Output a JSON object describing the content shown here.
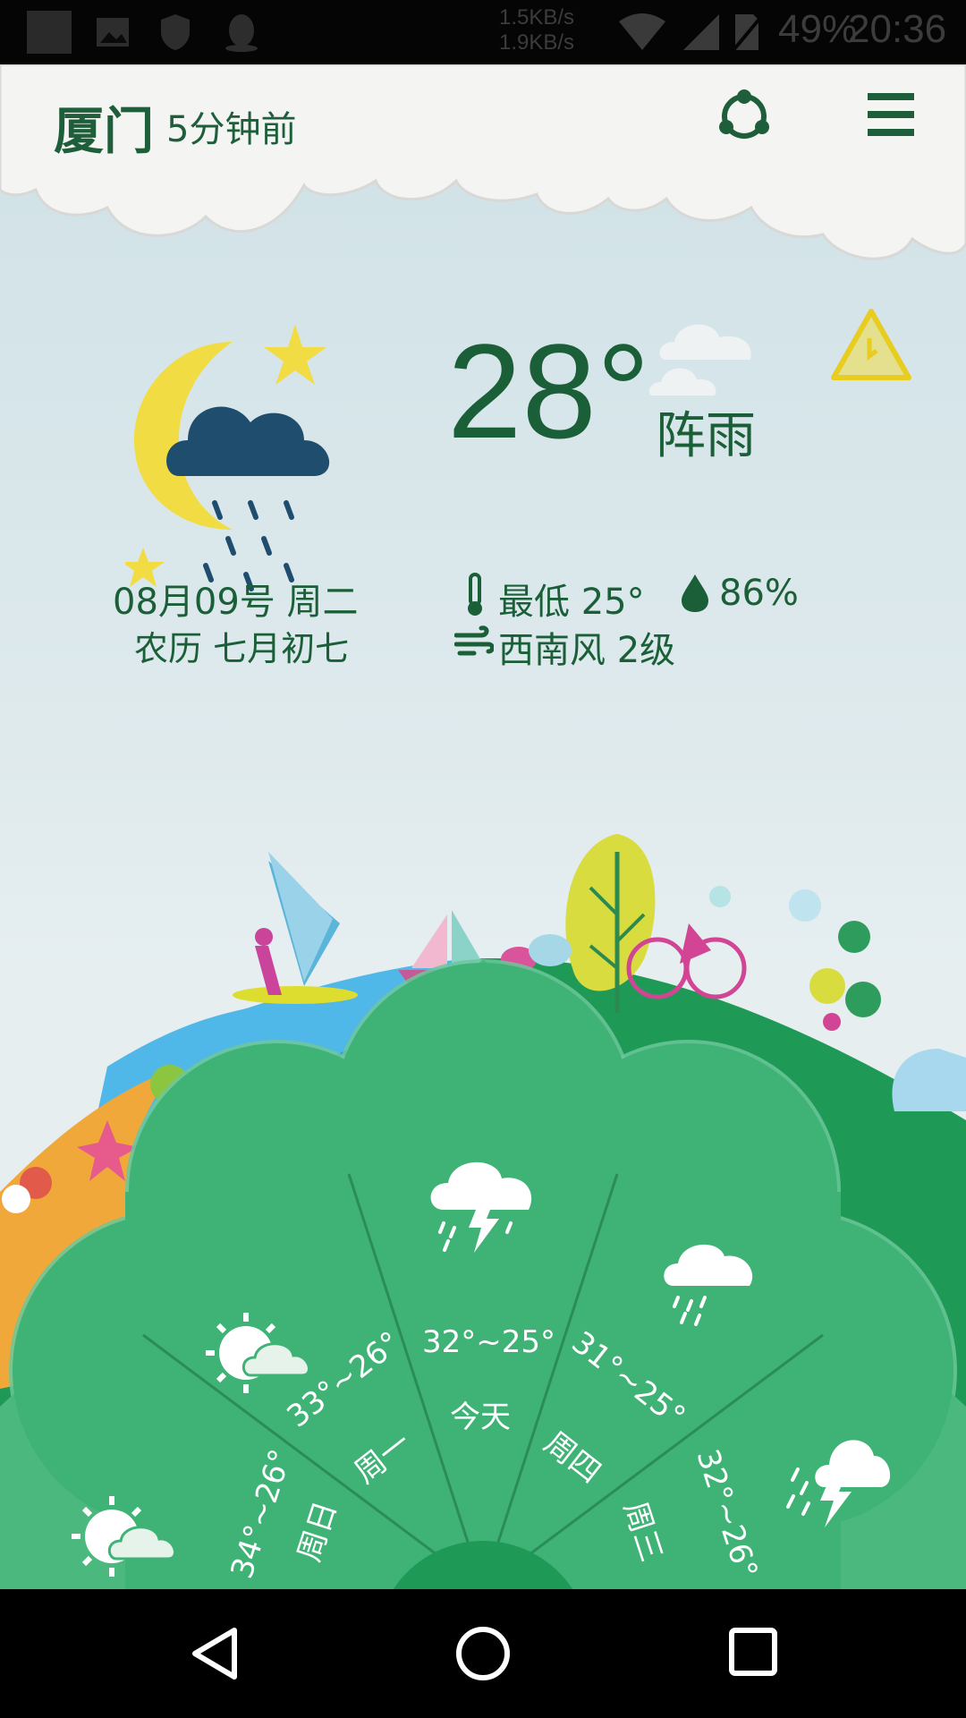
{
  "status_bar": {
    "net_up": "1.5KB/s",
    "net_down": "1.9KB/s",
    "battery": "49%",
    "time": "20:36",
    "icons": [
      "app-icon",
      "image-icon",
      "shield-icon",
      "qq-icon",
      "wifi-icon",
      "signal-icon",
      "no-sim-icon"
    ]
  },
  "header": {
    "city": "厦门",
    "updated": "5分钟前",
    "share_icon": "share-icon",
    "menu_icon": "menu-icon"
  },
  "current": {
    "temperature": "28°",
    "condition": "阵雨",
    "date": "08月09号 周二",
    "lunar": "农历 七月初七",
    "low": "最低 25°",
    "humidity": "86%",
    "wind": "西南风 2级",
    "weather_icon": "moon-cloud-rain-icon",
    "alert_icon": "warning-icon"
  },
  "forecast": [
    {
      "day": "周日",
      "range": "34°~26°",
      "icon": "sun-cloud-icon"
    },
    {
      "day": "周一",
      "range": "33°~26°",
      "icon": "sun-cloud-icon"
    },
    {
      "day": "今天",
      "range": "32°~25°",
      "icon": "thunder-rain-icon"
    },
    {
      "day": "周四",
      "range": "31°~25°",
      "icon": "cloud-rain-icon"
    },
    {
      "day": "周三",
      "range": "32°~26°",
      "icon": "thunder-rain-icon"
    }
  ],
  "colors": {
    "primary_text": "#1a5f38",
    "hill": "#1f9a56",
    "sea": "#4fb8e8",
    "sand": "#f0a83a",
    "forecast_panel": "#48b97c"
  },
  "nav": {
    "back": "back-icon",
    "home": "home-icon",
    "recents": "recents-icon"
  }
}
